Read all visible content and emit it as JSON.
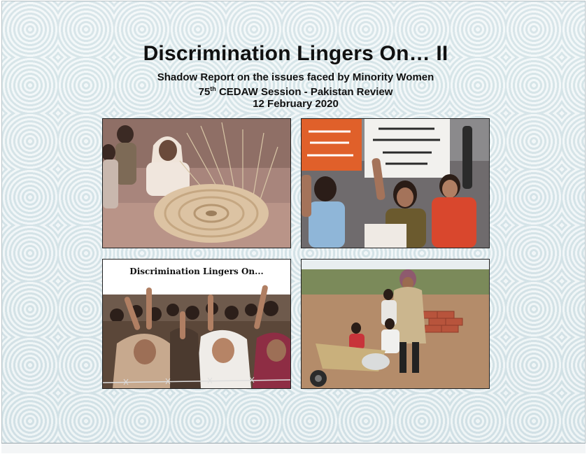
{
  "document": {
    "title": "Discrimination Lingers On… II",
    "subtitle": "Shadow Report on the issues faced by Minority Women",
    "session_number": "75",
    "session_suffix": "th",
    "session_rest": " CEDAW Session - Pakistan Review",
    "date": "12 February 2020"
  },
  "photos": [
    {
      "icon": "photo-woman-weaving-basket"
    },
    {
      "icon": "photo-women-protest-with-placards"
    },
    {
      "icon": "photo-protest-crowd",
      "caption": "Discrimination Lingers On..."
    },
    {
      "icon": "photo-woman-and-children-brick-work"
    }
  ],
  "colors": {
    "background": "#e1ecef",
    "title_text": "#111111",
    "photo_border": "#222222"
  }
}
